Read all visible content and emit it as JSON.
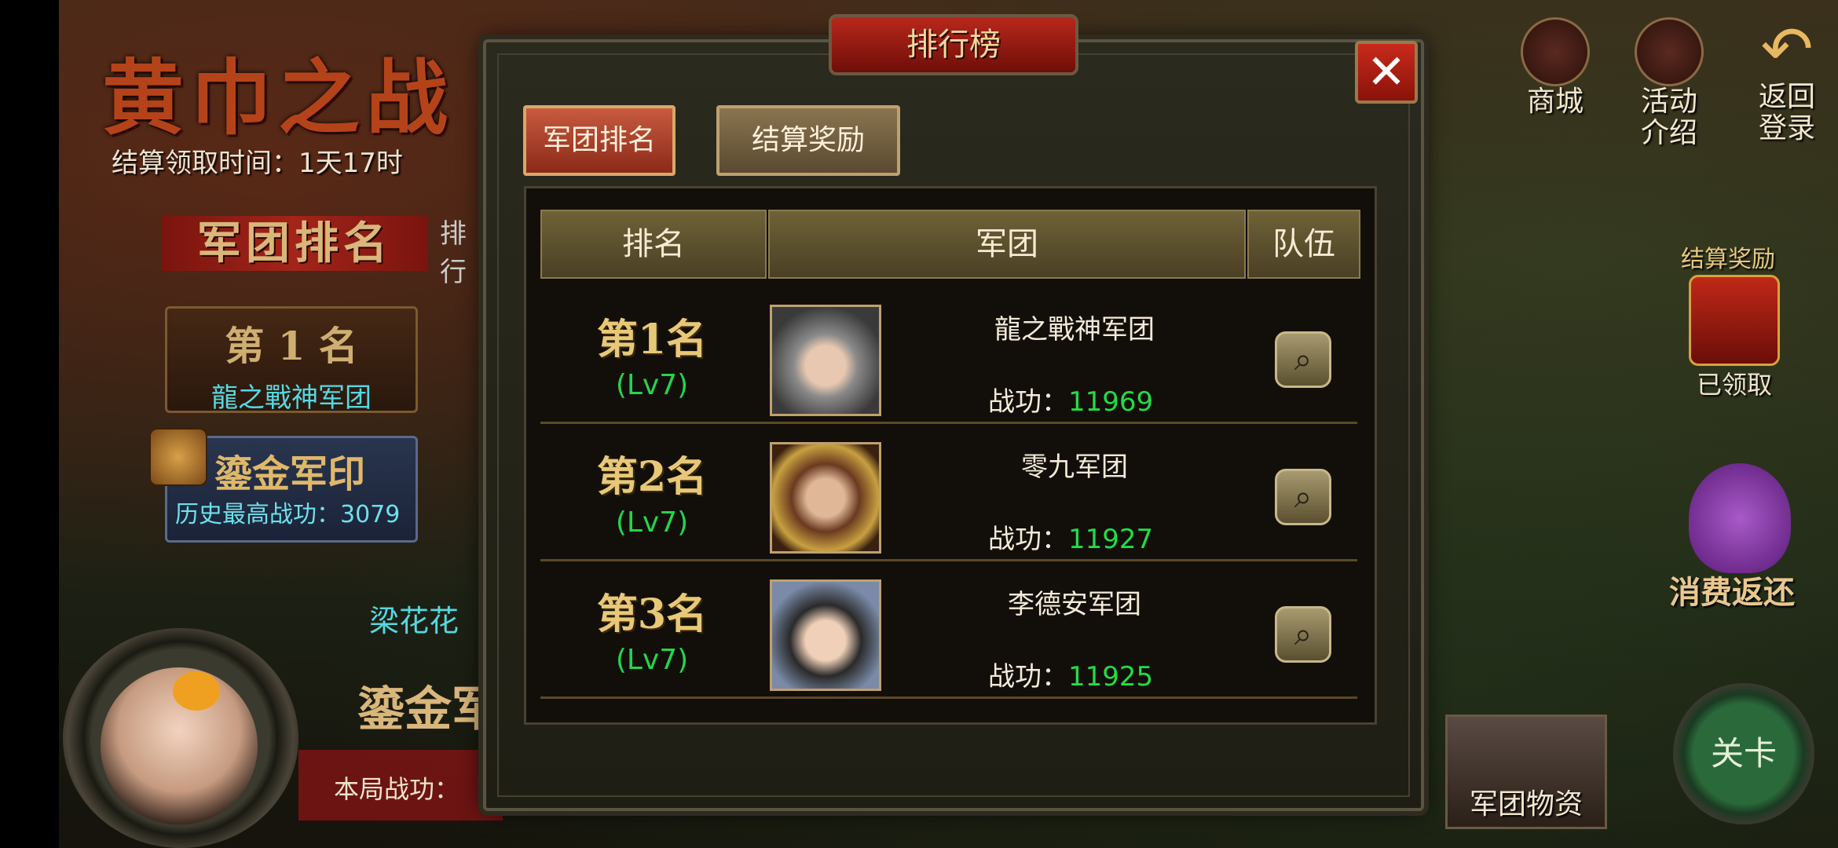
{
  "event": {
    "title": "黄巾之战",
    "settlement_time": "结算领取时间：1天17时",
    "banner": "军团排名",
    "side_tab": "排行",
    "my_rank": "第 1 名",
    "my_legion": "龍之戰神军团",
    "seal_title": "鎏金军印",
    "history_best": "历史最高战功：3079",
    "player_name": "梁花花",
    "big_seal": "鎏金军",
    "current_score_label": "本局战功："
  },
  "right_menu": {
    "shop": "商城",
    "activity": "活动\n介绍",
    "back": "返回\n登录",
    "settlement_reward": "结算奖励",
    "claimed": "已领取",
    "refund": "消费返还",
    "legion_supplies": "军团物资",
    "stage": "关卡"
  },
  "dialog": {
    "title": "排行榜",
    "close": "✕",
    "tabs": [
      {
        "label": "军团排名",
        "active": true
      },
      {
        "label": "结算奖励",
        "active": false
      }
    ],
    "headers": {
      "rank": "排名",
      "legion": "军团",
      "team": "队伍"
    },
    "rows": [
      {
        "rank": "第1名",
        "level": "(Lv7)",
        "legion": "龍之戰神军团",
        "merit_label": "战功：",
        "merit": "11969"
      },
      {
        "rank": "第2名",
        "level": "(Lv7)",
        "legion": "零九军团",
        "merit_label": "战功：",
        "merit": "11927"
      },
      {
        "rank": "第3名",
        "level": "(Lv7)",
        "legion": "李德安军团",
        "merit_label": "战功：",
        "merit": "11925"
      }
    ]
  },
  "colors": {
    "accent_red": "#b8281c",
    "merit_green": "#22dd44",
    "level_green": "#22d64a",
    "gold": "#e8c878"
  }
}
